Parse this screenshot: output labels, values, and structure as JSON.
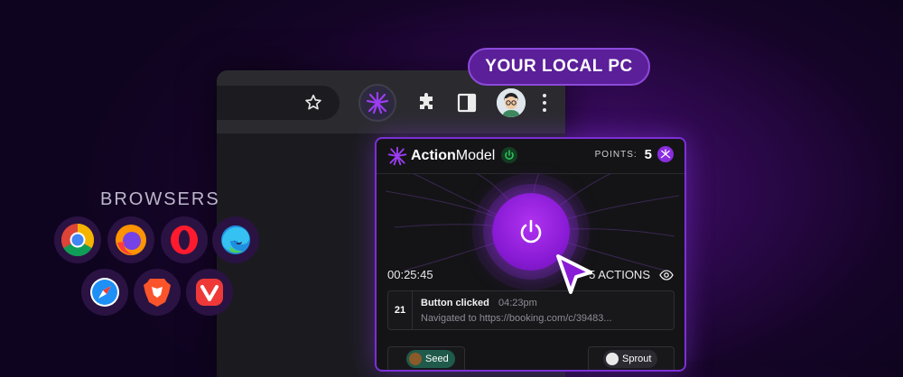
{
  "pill": {
    "label": "YOUR LOCAL PC"
  },
  "browsers": {
    "label": "BROWSERS",
    "icons": [
      "chrome-icon",
      "firefox-icon",
      "opera-icon",
      "edge-icon",
      "safari-icon",
      "brave-icon",
      "vivaldi-icon"
    ]
  },
  "browser_toolbar": {
    "icons": [
      "star-icon",
      "action-model-extension-icon",
      "puzzle-icon",
      "sidebar-icon",
      "avatar",
      "more-vert-icon"
    ]
  },
  "panel": {
    "brand_bold": "Action",
    "brand_rest": "Model",
    "points_label": "POINTS:",
    "points_value": "5",
    "timer": "00:25:45",
    "actions_label": "5 ACTIONS",
    "log": {
      "number": "21",
      "title": "Button clicked",
      "time": "04:23pm",
      "description": "Navigated to https://booking.com/c/39483..."
    },
    "tiers": [
      {
        "label": "Seed"
      },
      {
        "label": "Sprout"
      }
    ]
  },
  "colors": {
    "accent": "#8a1bd6",
    "pill_bg": "#5b1f99",
    "status_green": "#2fc25b"
  }
}
